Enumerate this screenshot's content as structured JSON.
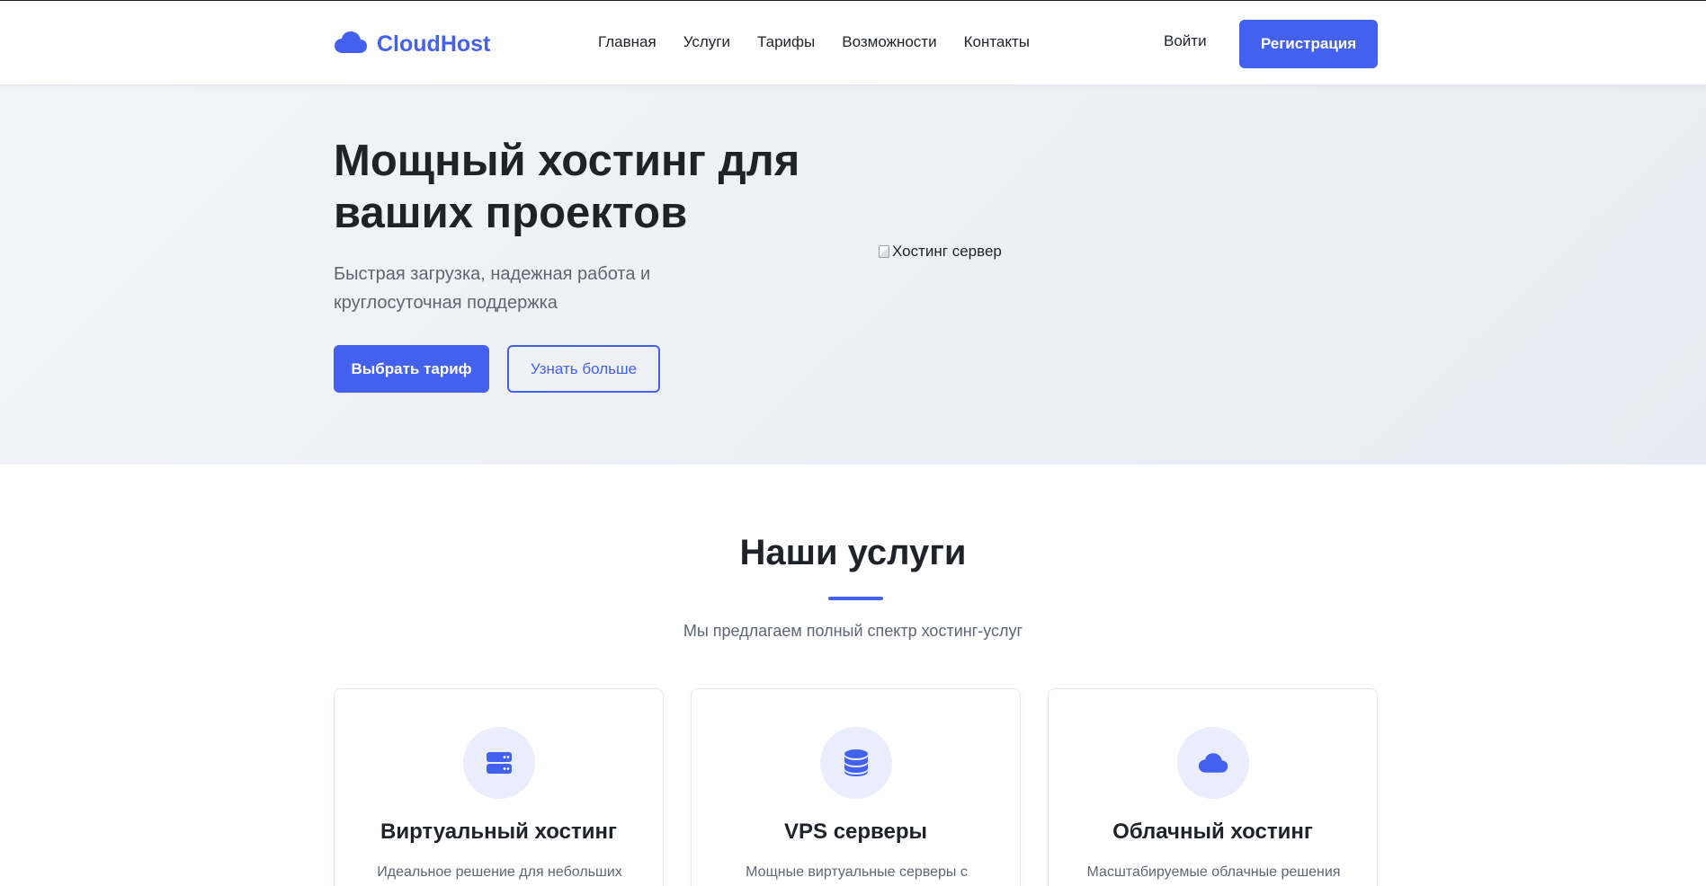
{
  "header": {
    "logo_text": "CloudHost",
    "logo_icon": "cloud-icon",
    "nav": [
      "Главная",
      "Услуги",
      "Тарифы",
      "Возможности",
      "Контакты"
    ],
    "login_label": "Войти",
    "register_label": "Регистрация"
  },
  "hero": {
    "title": "Мощный хостинг для ваших проектов",
    "subtitle": "Быстрая загрузка, надежная работа и круглосуточная поддержка",
    "primary_button": "Выбрать тариф",
    "secondary_button": "Узнать больше",
    "image_alt": "Хостинг сервер"
  },
  "services": {
    "title": "Наши услуги",
    "subtitle": "Мы предлагаем полный спектр хостинг-услуг",
    "cards": [
      {
        "icon": "server-icon",
        "title": "Виртуальный хостинг",
        "text": "Идеальное решение для небольших"
      },
      {
        "icon": "database-icon",
        "title": "VPS серверы",
        "text": "Мощные виртуальные серверы с"
      },
      {
        "icon": "cloud-icon",
        "title": "Облачный хостинг",
        "text": "Масштабируемые облачные решения"
      }
    ]
  },
  "colors": {
    "accent": "#4361ee",
    "icon_bg": "#eaedfb",
    "text": "#1f2328",
    "muted": "#5f6670"
  }
}
